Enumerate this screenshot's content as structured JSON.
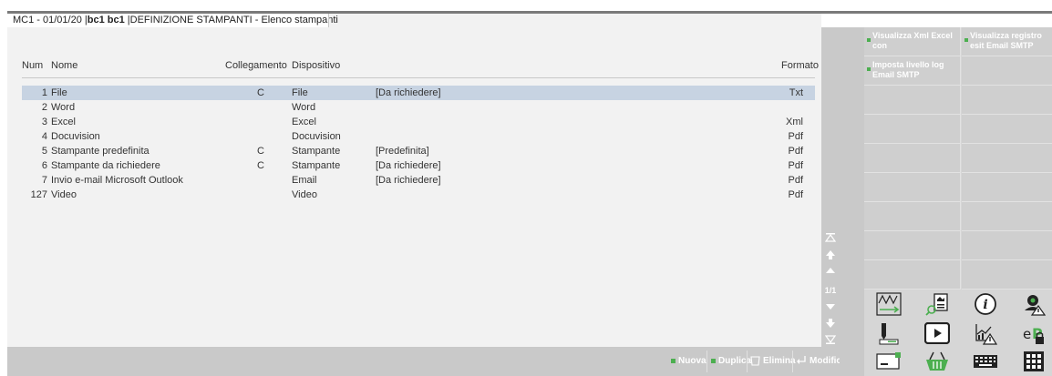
{
  "window": {
    "title_prefix": "MC1 - 01/01/20",
    "title_user": "bc1 bc1",
    "title_section": "DEFINIZIONE STAMPANTI - Elenco stampanti"
  },
  "table": {
    "headers": {
      "num": "Num",
      "nome": "Nome",
      "collegamento": "Collegamento",
      "dispositivo": "Dispositivo",
      "formato": "Formato"
    },
    "rows": [
      {
        "num": "1",
        "nome": "File",
        "coll": "C",
        "dispositivo": "File",
        "extra": "[Da richiedere]",
        "formato": "Txt"
      },
      {
        "num": "2",
        "nome": "Word",
        "coll": "",
        "dispositivo": "Word",
        "extra": "",
        "formato": ""
      },
      {
        "num": "3",
        "nome": "Excel",
        "coll": "",
        "dispositivo": "Excel",
        "extra": "",
        "formato": "Xml"
      },
      {
        "num": "4",
        "nome": "Docuvision",
        "coll": "",
        "dispositivo": "Docuvision",
        "extra": "",
        "formato": "Pdf"
      },
      {
        "num": "5",
        "nome": "Stampante predefinita",
        "coll": "C",
        "dispositivo": "Stampante",
        "extra": "[Predefinita]",
        "formato": "Pdf"
      },
      {
        "num": "6",
        "nome": "Stampante da richiedere",
        "coll": "C",
        "dispositivo": "Stampante",
        "extra": "[Da richiedere]",
        "formato": "Pdf"
      },
      {
        "num": "7",
        "nome": "Invio e-mail Microsoft Outlook",
        "coll": "",
        "dispositivo": "Email",
        "extra": "[Da richiedere]",
        "formato": "Pdf"
      },
      {
        "num": "127",
        "nome": "Video",
        "coll": "",
        "dispositivo": "Video",
        "extra": "",
        "formato": "Pdf"
      }
    ]
  },
  "pager": {
    "text": "1/1"
  },
  "bottom": {
    "nuova": "Nuova",
    "duplica": "Duplica",
    "elimina": "Elimina",
    "modifica": "Modifica"
  },
  "side": {
    "btn1": "Visualizza Xml Excel con",
    "btn2": "Visualizza registro esit Email SMTP",
    "btn3": "Imposta livello log Email SMTP"
  },
  "colors": {
    "accent_green": "#4caf50",
    "selection": "#c7d3e2",
    "panel_gray": "#c9c9c9"
  }
}
